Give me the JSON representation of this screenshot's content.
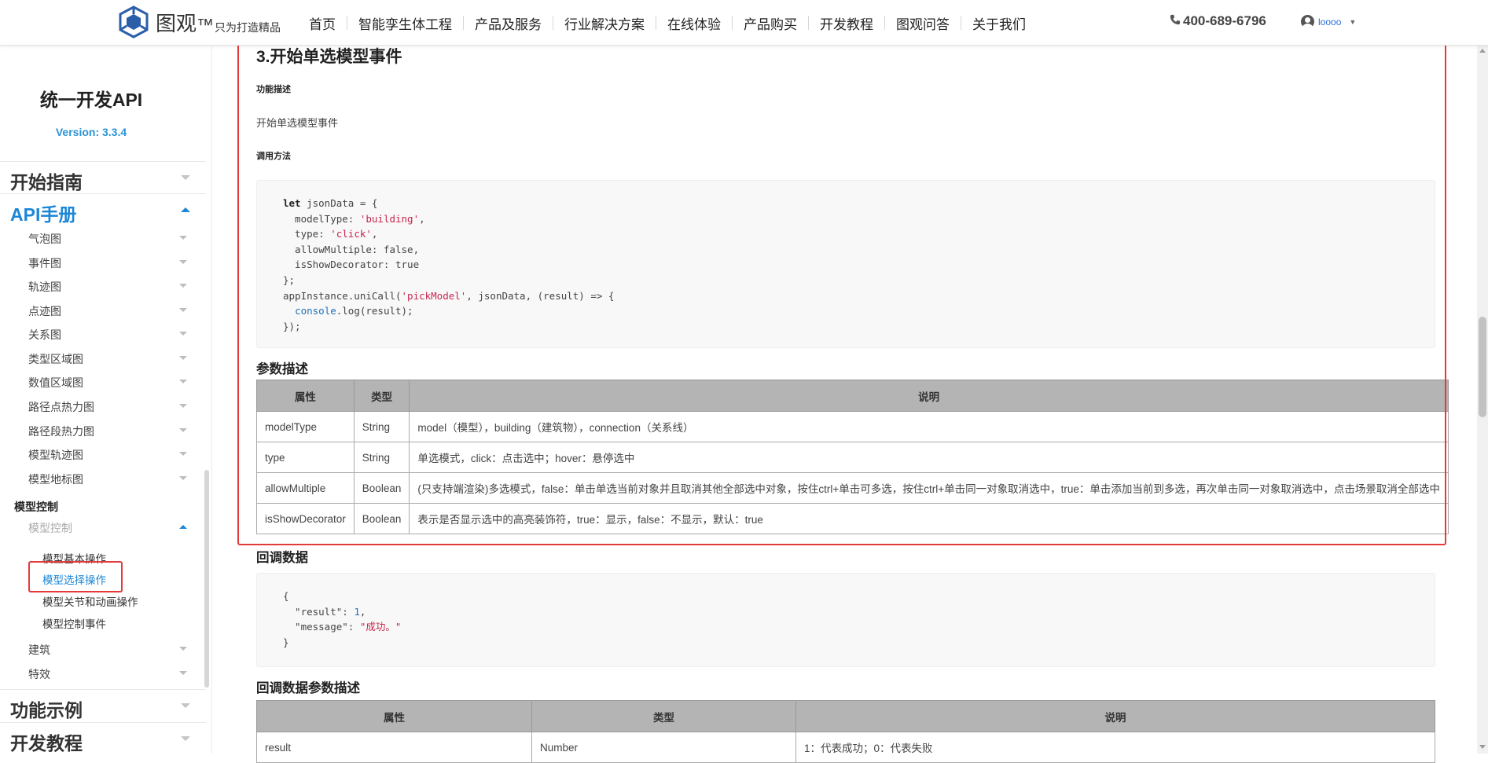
{
  "header": {
    "brand": "图观",
    "trademark": "™",
    "slogan": "只为打造精品",
    "nav": [
      "首页",
      "智能孪生体工程",
      "产品及服务",
      "行业解决方案",
      "在线体验",
      "产品购买",
      "开发教程",
      "图观问答",
      "关于我们"
    ],
    "phone": "400-689-6796",
    "username": "loooo"
  },
  "sidebar": {
    "title": "统一开发API",
    "version": "Version: 3.3.4",
    "sections": {
      "start": "开始指南",
      "api": "API手册",
      "examples": "功能示例",
      "tutorial": "开发教程"
    },
    "api_items": [
      "气泡图",
      "事件图",
      "轨迹图",
      "点迹图",
      "关系图",
      "类型区域图",
      "数值区域图",
      "路径点热力图",
      "路径段热力图",
      "模型轨迹图",
      "模型地标图"
    ],
    "group_label": "模型控制",
    "sub_label": "模型控制",
    "leaves": [
      "模型基本操作",
      "模型选择操作",
      "模型关节和动画操作",
      "模型控制事件"
    ],
    "after_items": [
      "建筑",
      "特效"
    ]
  },
  "content": {
    "section_title": "3.开始单选模型事件",
    "func_desc_label": "功能描述",
    "func_desc": "开始单选模型事件",
    "call_label": "调用方法",
    "code_lines": [
      [
        {
          "t": "let",
          "c": "kw"
        },
        {
          "t": " jsonData = {"
        }
      ],
      [
        {
          "t": "  modelType: "
        },
        {
          "t": "'building'",
          "c": "str"
        },
        {
          "t": ","
        }
      ],
      [
        {
          "t": "  type: "
        },
        {
          "t": "'click'",
          "c": "str"
        },
        {
          "t": ","
        }
      ],
      [
        {
          "t": "  allowMultiple: false,"
        }
      ],
      [
        {
          "t": "  isShowDecorator: true"
        }
      ],
      [
        {
          "t": "};"
        }
      ],
      [
        {
          "t": "appInstance.uniCall("
        },
        {
          "t": "'pickModel'",
          "c": "str"
        },
        {
          "t": ", jsonData, (result) => {"
        }
      ],
      [
        {
          "t": "  "
        },
        {
          "t": "console",
          "c": "blue"
        },
        {
          "t": ".log(result);"
        }
      ],
      [
        {
          "t": "});"
        }
      ]
    ],
    "param_title": "参数描述",
    "param_headers": [
      "属性",
      "类型",
      "说明"
    ],
    "param_rows": [
      [
        "modelType",
        "String",
        "model（模型），building（建筑物），connection（关系线）"
      ],
      [
        "type",
        "String",
        "单选模式，click：点击选中；hover：悬停选中"
      ],
      [
        "allowMultiple",
        "Boolean",
        "(只支持端渲染)多选模式，false：单击单选当前对象并且取消其他全部选中对象，按住ctrl+单击可多选，按住ctrl+单击同一对象取消选中，true：单击添加当前到多选，再次单击同一对象取消选中，点击场景取消全部选中"
      ],
      [
        "isShowDecorator",
        "Boolean",
        "表示是否显示选中的高亮装饰符，true：显示，false：不显示，默认：true"
      ]
    ],
    "callback_title": "回调数据",
    "callback_lines": [
      [
        {
          "t": "{"
        }
      ],
      [
        {
          "t": "  \"result\": "
        },
        {
          "t": "1",
          "c": "blue"
        },
        {
          "t": ","
        }
      ],
      [
        {
          "t": "  \"message\": "
        },
        {
          "t": "\"成功。\"",
          "c": "str"
        }
      ],
      [
        {
          "t": "}"
        }
      ]
    ],
    "callback_param_title": "回调数据参数描述",
    "callback_headers": [
      "属性",
      "类型",
      "说明"
    ],
    "callback_rows": [
      [
        "result",
        "Number",
        "1：代表成功；0：代表失败"
      ]
    ]
  },
  "colors": {
    "accent": "#1c86d6",
    "highlight_box": "#e53a3a",
    "table_header": "#b4b4b4"
  }
}
